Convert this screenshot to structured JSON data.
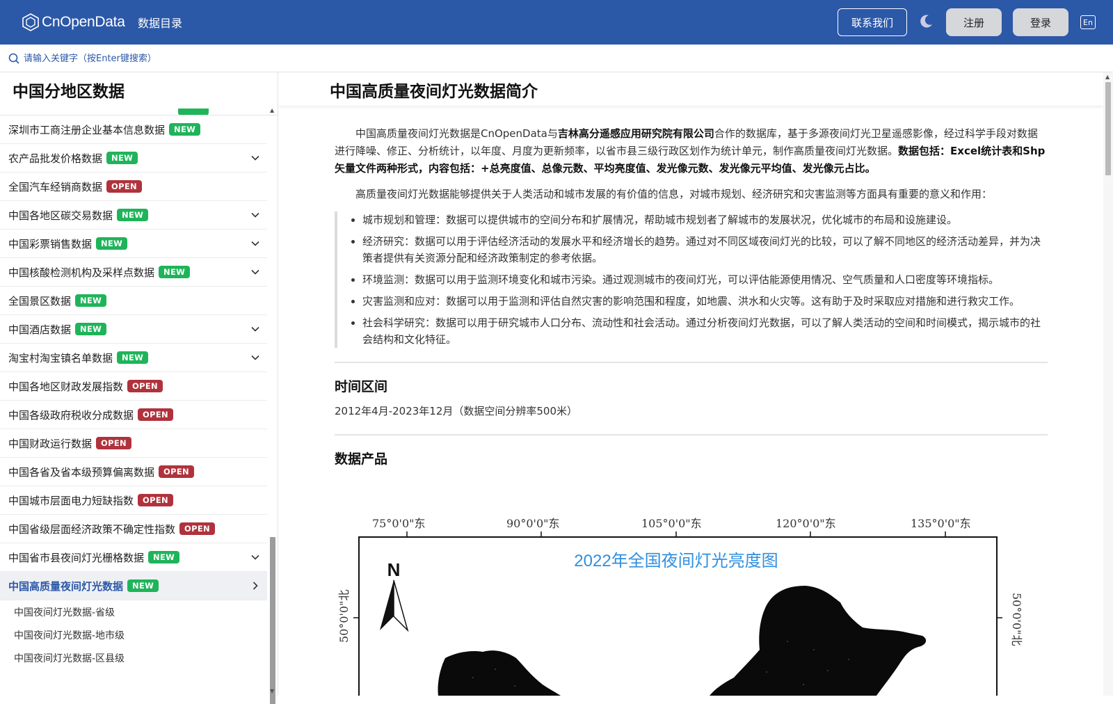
{
  "header": {
    "logo_text": "CnOpenData",
    "nav_catalog": "数据目录",
    "contact": "联系我们",
    "register": "注册",
    "login": "登录",
    "lang": "En"
  },
  "search": {
    "placeholder": "请输入关键字（按Enter键搜索）"
  },
  "sidebar": {
    "title": "中国分地区数据",
    "items": [
      {
        "label": "深圳市工商注册企业基本信息数据",
        "badge": "NEW",
        "expandable": false
      },
      {
        "label": "农产品批发价格数据",
        "badge": "NEW",
        "expandable": true
      },
      {
        "label": "全国汽车经销商数据",
        "badge": "OPEN",
        "expandable": false
      },
      {
        "label": "中国各地区碳交易数据",
        "badge": "NEW",
        "expandable": true
      },
      {
        "label": "中国彩票销售数据",
        "badge": "NEW",
        "expandable": true
      },
      {
        "label": "中国核酸检测机构及采样点数据",
        "badge": "NEW",
        "expandable": true
      },
      {
        "label": "全国景区数据",
        "badge": "NEW",
        "expandable": false
      },
      {
        "label": "中国酒店数据",
        "badge": "NEW",
        "expandable": true
      },
      {
        "label": "淘宝村淘宝镇名单数据",
        "badge": "NEW",
        "expandable": true
      },
      {
        "label": "中国各地区财政发展指数",
        "badge": "OPEN",
        "expandable": false
      },
      {
        "label": "中国各级政府税收分成数据",
        "badge": "OPEN",
        "expandable": false
      },
      {
        "label": "中国财政运行数据",
        "badge": "OPEN",
        "expandable": false
      },
      {
        "label": "中国各省及省本级预算偏离数据",
        "badge": "OPEN",
        "expandable": false
      },
      {
        "label": "中国城市层面电力短缺指数",
        "badge": "OPEN",
        "expandable": false
      },
      {
        "label": "中国省级层面经济政策不确定性指数",
        "badge": "OPEN",
        "expandable": false
      },
      {
        "label": "中国省市县夜间灯光栅格数据",
        "badge": "NEW",
        "expandable": true
      },
      {
        "label": "中国高质量夜间灯光数据",
        "badge": "NEW",
        "expandable": true,
        "active": true
      }
    ],
    "sub_items": [
      "中国夜间灯光数据-省级",
      "中国夜间灯光数据-地市级",
      "中国夜间灯光数据-区县级"
    ]
  },
  "main": {
    "title": "中国高质量夜间灯光数据简介",
    "intro_1": "中国高质量夜间灯光数据是CnOpenData与",
    "intro_org": "吉林高分遥感应用研究院有限公司",
    "intro_2": "合作的数据库，基于多源夜间灯光卫星遥感影像，经过科学手段对数据进行降噪、修正、分析统计，以年度、月度为更新频率，以省市县三级行政区划作为统计单元，制作高质量夜间灯光数据。",
    "intro_bold": "数据包括：Excel统计表和Shp矢量文件两种形式，内容包括：+总亮度值、总像元数、平均亮度值、发光像元数、发光像元平均值、发光像元占比。",
    "value_para": "高质量夜间灯光数据能够提供关于人类活动和城市发展的有价值的信息，对城市规划、经济研究和灾害监测等方面具有重要的意义和作用：",
    "bullets": [
      "城市规划和管理：数据可以提供城市的空间分布和扩展情况，帮助城市规划者了解城市的发展状况，优化城市的布局和设施建设。",
      "经济研究：数据可以用于评估经济活动的发展水平和经济增长的趋势。通过对不同区域夜间灯光的比较，可以了解不同地区的经济活动差异，并为决策者提供有关资源分配和经济政策制定的参考依据。",
      "环境监测：数据可以用于监测环境变化和城市污染。通过观测城市的夜间灯光，可以评估能源使用情况、空气质量和人口密度等环境指标。",
      "灾害监测和应对：数据可以用于监测和评估自然灾害的影响范围和程度，如地震、洪水和火灾等。这有助于及时采取应对措施和进行救灾工作。",
      "社会科学研究：数据可以用于研究城市人口分布、流动性和社会活动。通过分析夜间灯光数据，可以了解人类活动的空间和时间模式，揭示城市的社会结构和文化特征。"
    ],
    "time_heading": "时间区间",
    "time_range": "2012年4月-2023年12月（数据空间分辨率500米）",
    "product_heading": "数据产品",
    "map": {
      "title": "2022年全国夜间灯光亮度图",
      "lon_labels": [
        "75°0'0\"东",
        "90°0'0\"东",
        "105°0'0\"东",
        "120°0'0\"东",
        "135°0'0\"东"
      ],
      "lat_label_left": "50°0'0\"北",
      "lat_label_right": "50°0'0\"北",
      "north_label": "N"
    }
  },
  "colors": {
    "brand": "#2c58a8",
    "badge_new": "#1fb45a",
    "badge_open": "#b0323c"
  }
}
